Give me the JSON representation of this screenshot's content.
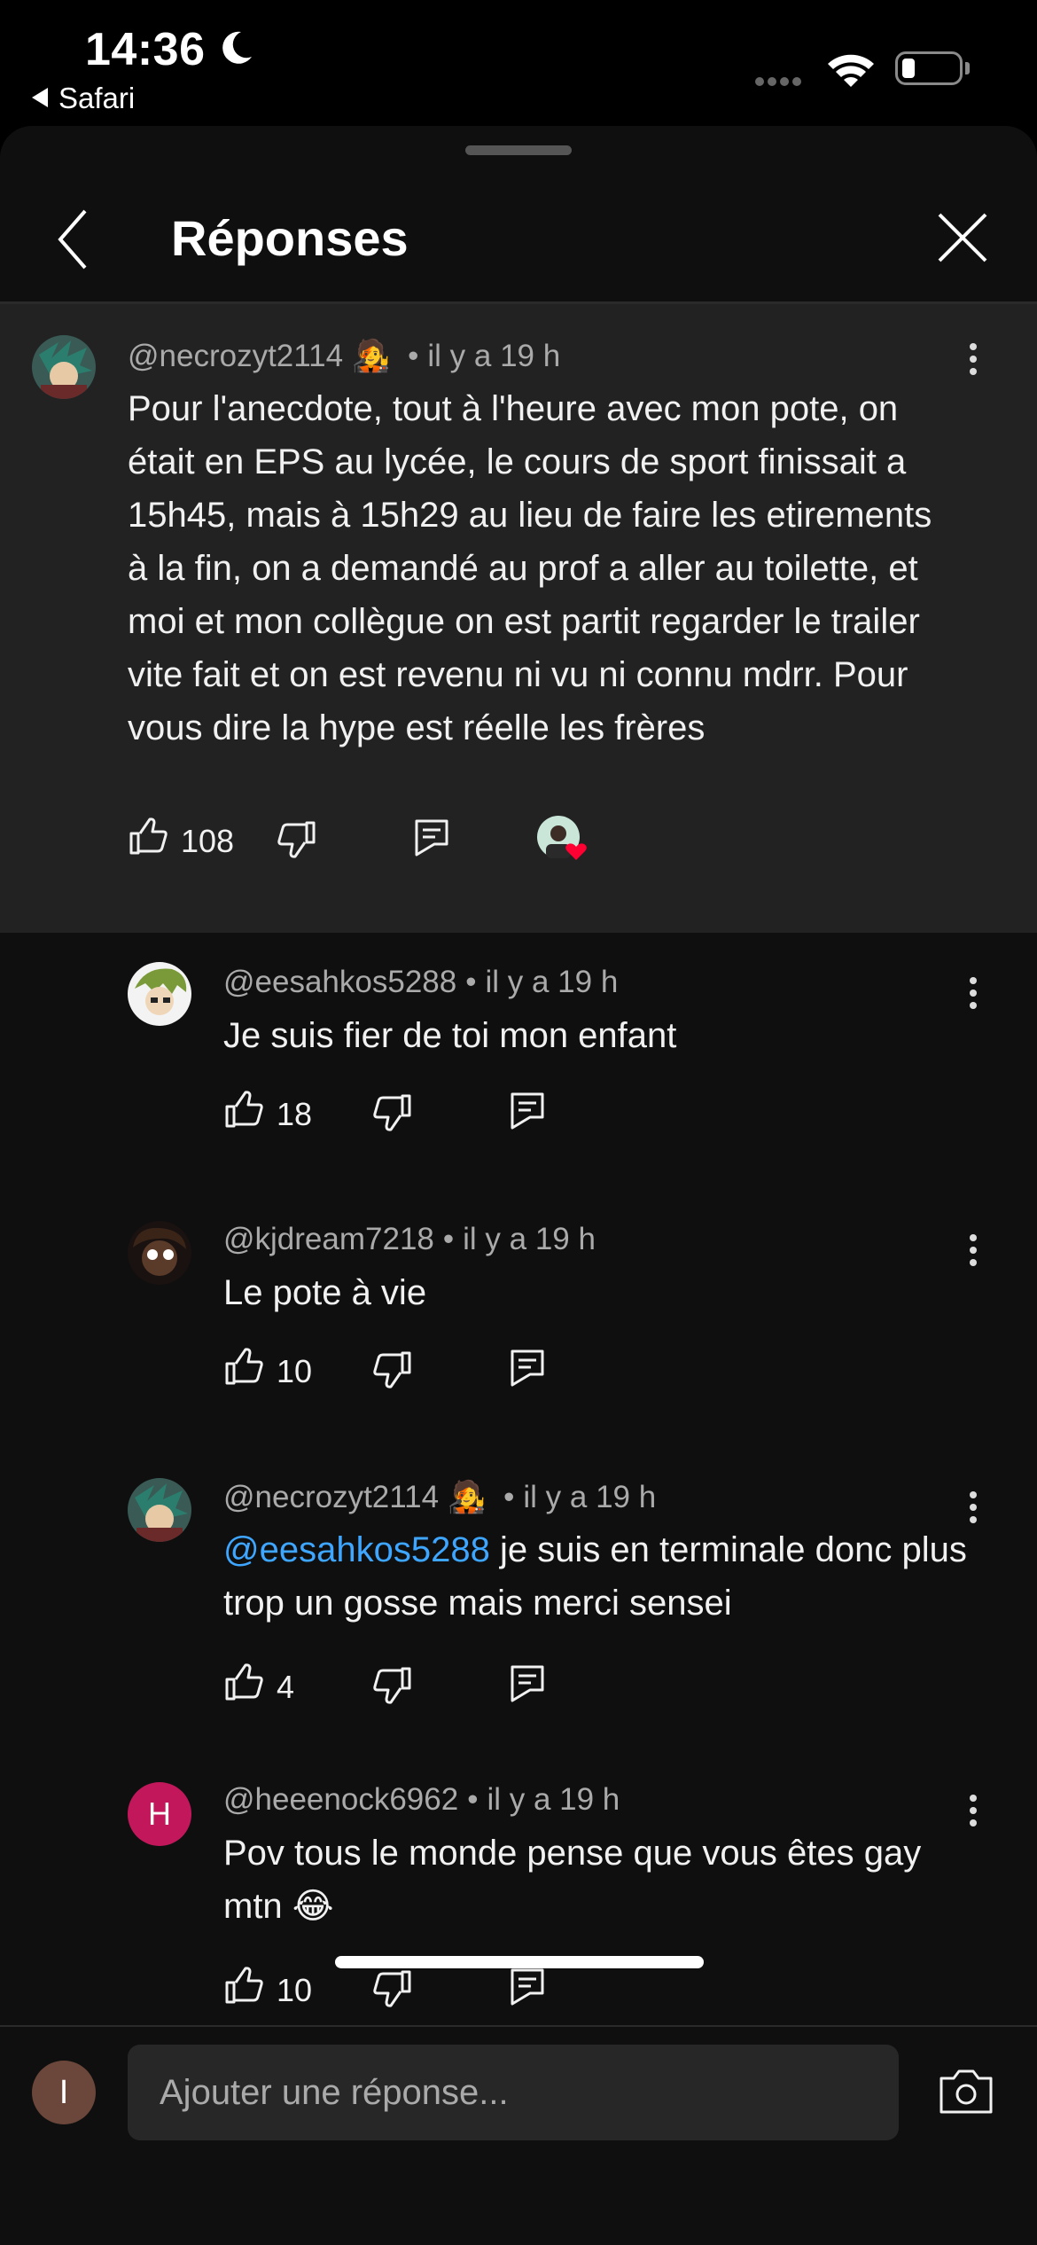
{
  "status": {
    "time": "14:36",
    "back_app": "Safari"
  },
  "header": {
    "title": "Réponses"
  },
  "parent_comment": {
    "author": "@necrozyt2114",
    "author_emoji": "🧑‍🎤",
    "time": "il y a 19 h",
    "separator": "•",
    "text": "Pour l'anecdote, tout à l'heure avec mon pote, on était en EPS au lycée, le cours de sport finissait a 15h45, mais à 15h29 au lieu de faire les etirements à la fin, on a demandé au prof a aller au toilette, et moi et mon collègue on est partit regarder le trailer vite fait et on est revenu ni vu ni connu mdrr. Pour vous dire la hype est réelle les frères",
    "likes": "108"
  },
  "replies": [
    {
      "author": "@eesahkos5288",
      "time": "il y a 19 h",
      "mention": "",
      "text": "Je suis fier de toi mon enfant",
      "likes": "18"
    },
    {
      "author": "@kjdream7218",
      "time": "il y a 19 h",
      "mention": "",
      "text": "Le pote à vie",
      "likes": "10"
    },
    {
      "author": "@necrozyt2114",
      "time": "il y a 19 h",
      "mention": "@eesahkos5288",
      "text": " je suis en terminale donc plus trop un gosse mais merci sensei",
      "likes": "4"
    },
    {
      "author": "@heeenock6962",
      "avatar_letter": "H",
      "time": "il y a 19 h",
      "mention": "",
      "text": "Pov tous le monde pense que vous êtes gay mtn 😂",
      "likes": "10"
    }
  ],
  "compose": {
    "avatar_letter": "I",
    "placeholder": "Ajouter une réponse..."
  },
  "colors": {
    "background": "#0f0f0f",
    "highlight": "#222222",
    "mention": "#3ea6ff",
    "heart": "#ff0033"
  }
}
